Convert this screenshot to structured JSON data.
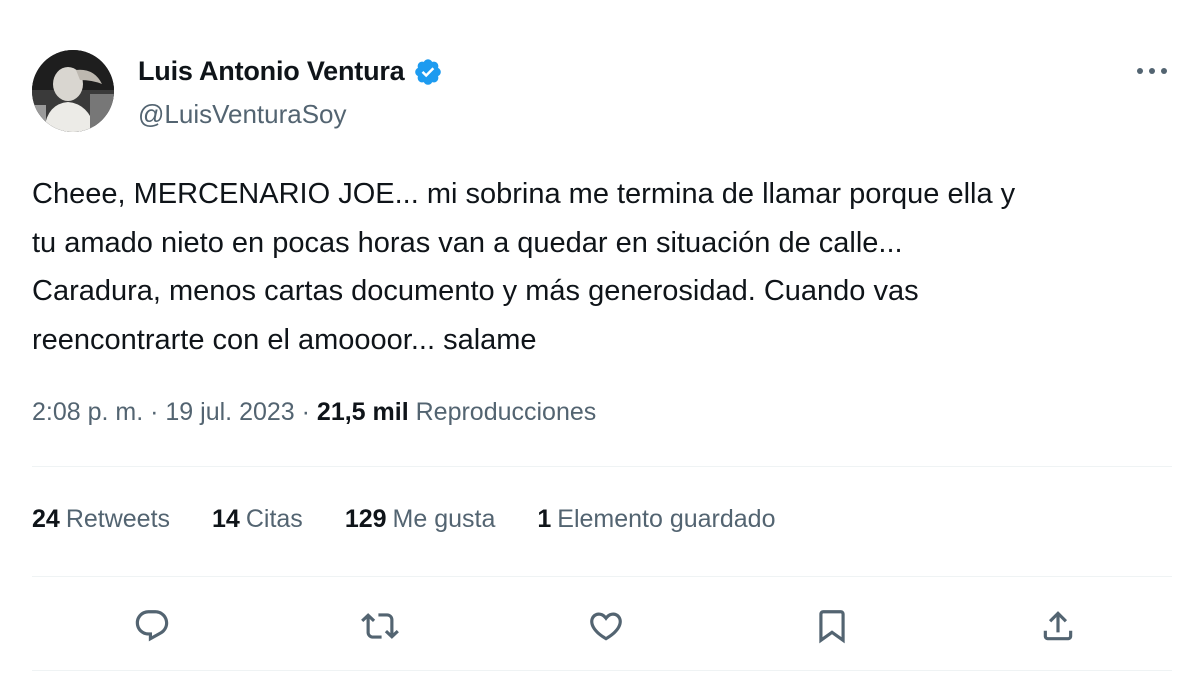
{
  "author": {
    "display_name": "Luis Antonio Ventura",
    "handle": "@LuisVenturaSoy",
    "verified": true,
    "verified_color": "#1d9bf0"
  },
  "tweet": {
    "text_lines": [
      "Cheee, MERCENARIO JOE... mi sobrina me termina de llamar porque ella y",
      "tu amado nieto en pocas horas van a quedar en situación de calle...",
      "Caradura, menos cartas documento y más generosidad. Cuando vas",
      "reencontrarte con el amoooor... salame"
    ]
  },
  "meta": {
    "time": "2:08 p. m.",
    "separator": "·",
    "date": "19 jul. 2023",
    "views_count": "21,5 mil",
    "views_label": "Reproducciones"
  },
  "stats": [
    {
      "count": "24",
      "label": "Retweets"
    },
    {
      "count": "14",
      "label": "Citas"
    },
    {
      "count": "129",
      "label": "Me gusta"
    },
    {
      "count": "1",
      "label": "Elemento guardado"
    }
  ],
  "actions": [
    "reply-icon",
    "retweet-icon",
    "like-icon",
    "bookmark-icon",
    "share-icon"
  ],
  "colors": {
    "text_primary": "#0f1419",
    "text_secondary": "#536471",
    "divider": "#eff3f4",
    "icon": "#536471"
  }
}
